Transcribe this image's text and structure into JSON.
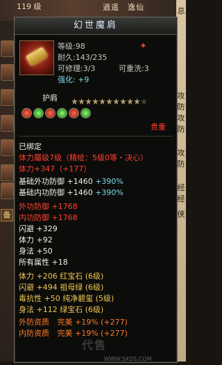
{
  "hud": {
    "level": "119 级",
    "title": "逍遥　逸仙",
    "right_chars": [
      "总",
      "攻",
      "防",
      "攻",
      "防",
      "攻",
      "防",
      "经",
      "经",
      "侠"
    ],
    "left_tab": "备"
  },
  "item": {
    "name": "幻世魔肩",
    "level": "等级:98",
    "durability": "耐久:143/235",
    "repairable": "可修理:3/3",
    "rewashable": "可重洗:3",
    "enhance_label": "强化:",
    "enhance_value": "+9",
    "slot": "护肩",
    "rarity": "贵重",
    "bound": "已绑定",
    "refine": "体力屬级7级（精绘：5级0等・决心）",
    "stamina_bonus": "体力+347（+177）",
    "stars": {
      "total": 11,
      "filled": 10
    },
    "gems": [
      "red",
      "green",
      "red",
      "green",
      "red",
      "green"
    ],
    "stats": [
      {
        "label": "基础外功防御 +1460",
        "extra": "+390%"
      },
      {
        "label": "基础内功防御 +1460",
        "extra": "+390%"
      }
    ],
    "attributes": [
      {
        "text": "外功防御 +1768",
        "color": "red"
      },
      {
        "text": "内功防御 +1768",
        "color": "red"
      },
      {
        "text": "闪避 +329",
        "color": "white"
      },
      {
        "text": "体力 +92",
        "color": "white"
      },
      {
        "text": "身法 +50",
        "color": "white"
      },
      {
        "text": "所有属性 +18",
        "color": "white"
      }
    ],
    "gem_stats": [
      {
        "text": "体力 +206  红宝石 (6级)"
      },
      {
        "text": "闪避 +494  祖母绿 (6级)"
      },
      {
        "text": "毒抗性 +50  纯净碧玺 (5级)"
      },
      {
        "text": "身法 +112  绿宝石 (6级)"
      }
    ],
    "qualities": [
      {
        "label": "外防资质",
        "value": "完美 +19% (+277)"
      },
      {
        "label": "内防资质",
        "value": "完美 +19% (+277)"
      }
    ]
  },
  "watermark": {
    "text": "代售",
    "url": "WWW.SXDS.COM"
  }
}
